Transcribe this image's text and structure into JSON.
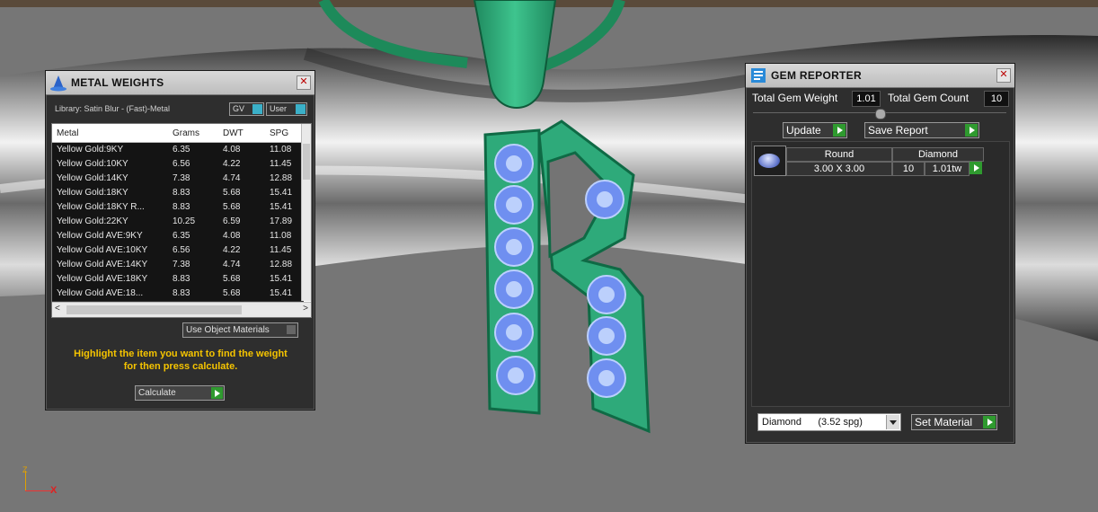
{
  "metal_weights": {
    "title": "METAL WEIGHTS",
    "library": "Library: Satin Blur - (Fast)-Metal",
    "toggle_gv": "GV",
    "toggle_user": "User",
    "columns": [
      "Metal",
      "Grams",
      "DWT",
      "SPG"
    ],
    "rows": [
      {
        "metal": "Yellow Gold:9KY",
        "grams": "6.35",
        "dwt": "4.08",
        "spg": "11.08"
      },
      {
        "metal": "Yellow Gold:10KY",
        "grams": "6.56",
        "dwt": "4.22",
        "spg": "11.45"
      },
      {
        "metal": "Yellow Gold:14KY",
        "grams": "7.38",
        "dwt": "4.74",
        "spg": "12.88"
      },
      {
        "metal": "Yellow Gold:18KY",
        "grams": "8.83",
        "dwt": "5.68",
        "spg": "15.41"
      },
      {
        "metal": "Yellow Gold:18KY R...",
        "grams": "8.83",
        "dwt": "5.68",
        "spg": "15.41"
      },
      {
        "metal": "Yellow Gold:22KY",
        "grams": "10.25",
        "dwt": "6.59",
        "spg": "17.89"
      },
      {
        "metal": "Yellow Gold AVE:9KY",
        "grams": "6.35",
        "dwt": "4.08",
        "spg": "11.08"
      },
      {
        "metal": "Yellow Gold AVE:10KY",
        "grams": "6.56",
        "dwt": "4.22",
        "spg": "11.45"
      },
      {
        "metal": "Yellow Gold AVE:14KY",
        "grams": "7.38",
        "dwt": "4.74",
        "spg": "12.88"
      },
      {
        "metal": "Yellow Gold AVE:18KY",
        "grams": "8.83",
        "dwt": "5.68",
        "spg": "15.41"
      },
      {
        "metal": "Yellow Gold AVE:18...",
        "grams": "8.83",
        "dwt": "5.68",
        "spg": "15.41"
      }
    ],
    "use_object_materials": "Use Object Materials",
    "hint_line1": "Highlight the item you want to find the weight",
    "hint_line2": "for then press calculate.",
    "calculate": "Calculate"
  },
  "gem_reporter": {
    "title": "GEM REPORTER",
    "total_weight_label": "Total Gem Weight",
    "total_weight_value": "1.01",
    "total_count_label": "Total Gem Count",
    "total_count_value": "10",
    "update": "Update",
    "save_report": "Save Report",
    "gem": {
      "shape": "Round",
      "type": "Diamond",
      "size": "3.00 X 3.00",
      "count": "10",
      "weight": "1.01tw"
    },
    "material_select": "Diamond      (3.52 spg)",
    "set_material": "Set Material"
  },
  "axis": {
    "z": "Z",
    "x": "X"
  },
  "colors": {
    "accent_go": "#2f9a2f",
    "hint": "#f5c400",
    "pendant": "#2eaa7a",
    "gem": "#6f8ff0"
  }
}
